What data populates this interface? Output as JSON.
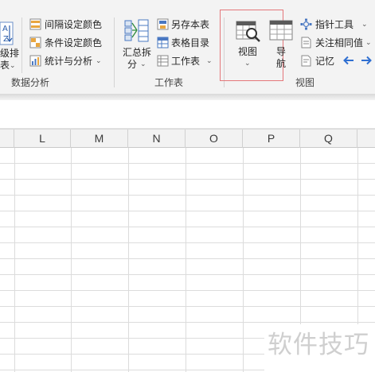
{
  "ribbon": {
    "sort_partial": {
      "line1": "级排",
      "line2": "表"
    },
    "data_analysis": {
      "group_label": "数据分析",
      "items": [
        {
          "label": "间隔设定颜色",
          "icon": "interval-color-icon"
        },
        {
          "label": "条件设定颜色",
          "icon": "condition-color-icon"
        },
        {
          "label": "统计与分析",
          "icon": "statistics-icon"
        }
      ]
    },
    "worksheet": {
      "group_label": "工作表",
      "summary_split": {
        "line1": "汇总拆",
        "line2": "分"
      },
      "items": [
        {
          "label": "另存本表",
          "icon": "save-sheet-icon"
        },
        {
          "label": "表格目录",
          "icon": "table-catalog-icon"
        },
        {
          "label": "工作表",
          "icon": "worksheet-icon"
        }
      ]
    },
    "view": {
      "group_label": "视图",
      "view_button": "视图",
      "nav_button": {
        "line1": "导",
        "line2": "航"
      },
      "items": [
        {
          "label": "指针工具",
          "icon": "pointer-tool-icon"
        },
        {
          "label": "关注相同值",
          "icon": "focus-same-value-icon"
        },
        {
          "label": "记忆",
          "icon": "memory-icon"
        }
      ]
    },
    "highlight_color": "#e4777a"
  },
  "sheet": {
    "columns": [
      "L",
      "M",
      "N",
      "O",
      "P",
      "Q"
    ]
  },
  "watermark": "软件技巧"
}
